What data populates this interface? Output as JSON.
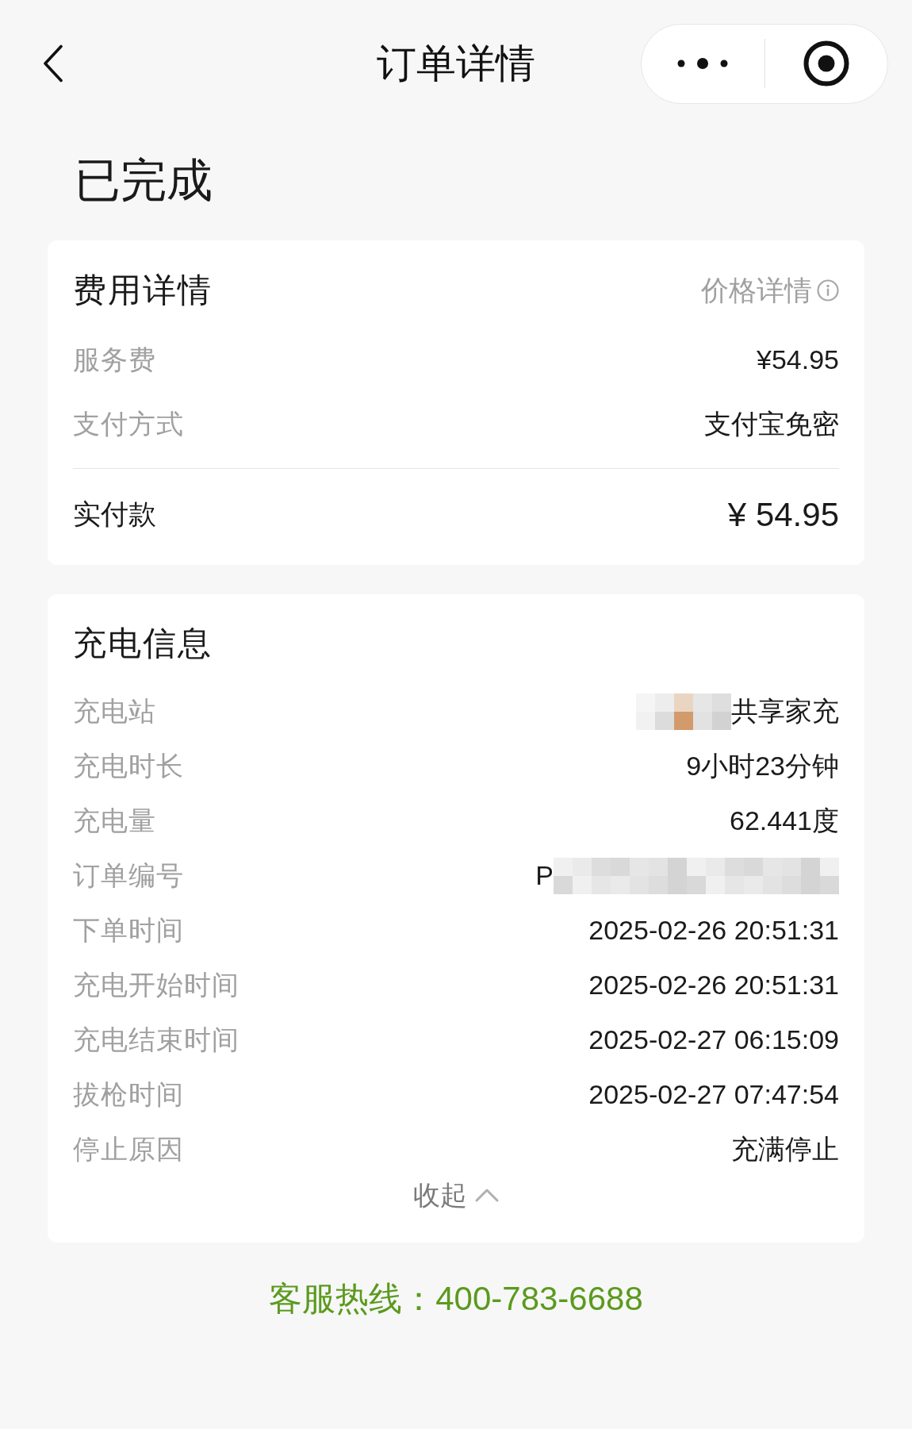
{
  "nav": {
    "title": "订单详情"
  },
  "status": "已完成",
  "fee_card": {
    "title": "费用详情",
    "link": "价格详情",
    "rows": [
      {
        "label": "服务费",
        "value": "¥54.95"
      },
      {
        "label": "支付方式",
        "value": "支付宝免密"
      }
    ],
    "total": {
      "label": "实付款",
      "value": "¥ 54.95"
    }
  },
  "charging_card": {
    "title": "充电信息",
    "rows": [
      {
        "kind": "masked_prefix",
        "label": "充电站",
        "value": "共享家充"
      },
      {
        "kind": "plain",
        "label": "充电时长",
        "value": "9小时23分钟"
      },
      {
        "kind": "plain",
        "label": "充电量",
        "value": "62.441度"
      },
      {
        "kind": "masked_suffix",
        "label": "订单编号",
        "value": "P"
      },
      {
        "kind": "plain",
        "label": "下单时间",
        "value": "2025-02-26 20:51:31"
      },
      {
        "kind": "plain",
        "label": "充电开始时间",
        "value": "2025-02-26 20:51:31"
      },
      {
        "kind": "plain",
        "label": "充电结束时间",
        "value": "2025-02-27 06:15:09"
      },
      {
        "kind": "plain",
        "label": "拔枪时间",
        "value": "2025-02-27 07:47:54"
      },
      {
        "kind": "plain",
        "label": "停止原因",
        "value": "充满停止"
      }
    ],
    "collapse": {
      "label": "收起",
      "expanded": true
    }
  },
  "hotline": "客服热线：400-783-6688"
}
